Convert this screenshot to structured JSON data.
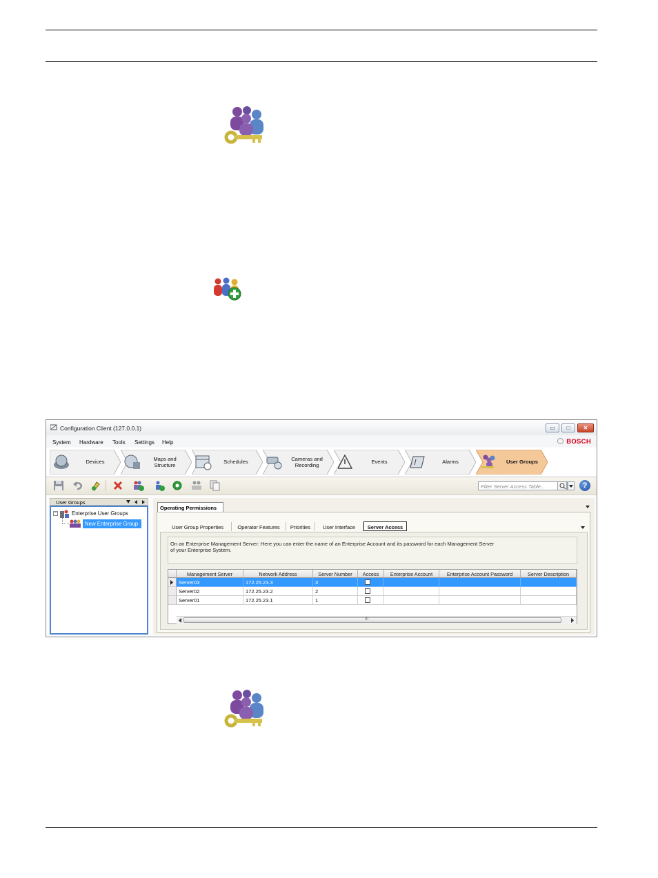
{
  "window": {
    "title": "Configuration Client (127.0.0.1)",
    "brand": "BOSCH",
    "controls": {
      "minimize": "▭",
      "maximize": "□",
      "close": "✕"
    }
  },
  "menu": [
    "System",
    "Hardware",
    "Tools",
    "Settings",
    "Help"
  ],
  "nav_tabs": [
    {
      "label": "Devices",
      "icon": "devices-icon"
    },
    {
      "label": "Maps and Structure",
      "icon": "maps-icon"
    },
    {
      "label": "Schedules",
      "icon": "schedules-icon"
    },
    {
      "label": "Cameras and Recording",
      "icon": "cameras-icon"
    },
    {
      "label": "Events",
      "icon": "events-icon"
    },
    {
      "label": "Alarms",
      "icon": "alarms-icon"
    },
    {
      "label": "User Groups",
      "icon": "user-groups-icon",
      "active": true
    }
  ],
  "toolbar": {
    "filter_placeholder": "Filter Server Access Table...",
    "help_label": "?"
  },
  "left_panel": {
    "title": "User Groups",
    "tree": {
      "root": "Enterprise User Groups",
      "child": "New Enterprise Group"
    }
  },
  "right_panel": {
    "main_tab": "Operating Permissions",
    "sub_tabs": [
      "User Group Properties",
      "Operator Features",
      "Priorities",
      "User Interface",
      "Server Access"
    ],
    "active_sub_tab": "Server Access",
    "description_line1": "On an Enterprise Management Server: Here you can enter the name of an Enterprise Account and its password for each Management Server",
    "description_line2": "of your Enterprise System.",
    "table": {
      "columns": [
        "Management Server",
        "Network Address",
        "Server Number",
        "Access",
        "Enterprise Account",
        "Enterprise Account Password",
        "Server Description"
      ],
      "rows": [
        {
          "server": "Server03",
          "address": "172.25.23.3",
          "number": "3",
          "selected": true
        },
        {
          "server": "Server02",
          "address": "172.25.23.2",
          "number": "2",
          "selected": false
        },
        {
          "server": "Server01",
          "address": "172.25.23.1",
          "number": "1",
          "selected": false
        }
      ],
      "scroll_mid": "III"
    }
  },
  "colors": {
    "accent_tab": "#f5c89a",
    "selection": "#3399ff",
    "brand_red": "#d6001c"
  }
}
